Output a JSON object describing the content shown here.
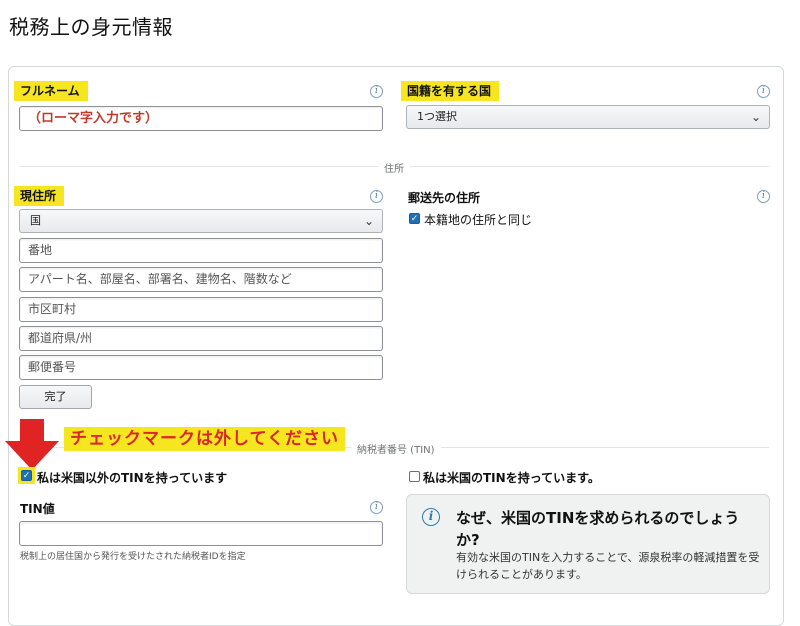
{
  "page": {
    "title": "税務上の身元情報"
  },
  "fullname": {
    "label": "フルネーム",
    "value": "（ローマ字入力です）"
  },
  "nationality": {
    "label": "国籍を有する国",
    "selected": "1つ選択"
  },
  "address_section": {
    "divider_label": "住所"
  },
  "current_address": {
    "label": "現住所",
    "country_selected": "国",
    "fields": [
      "番地",
      "アパート名、部屋名、部署名、建物名、階数など",
      "市区町村",
      "都道府県/州",
      "郵便番号"
    ],
    "done_button": "完了"
  },
  "mailing_address": {
    "label": "郵送先の住所",
    "same_as_label": "本籍地の住所と同じ",
    "same_as_checked": true
  },
  "tin_section": {
    "divider_label": "納税者番号 (TIN)"
  },
  "annotation": {
    "text": "チェックマークは外してください",
    "arrow_color": "#e02424"
  },
  "tin": {
    "non_us_option": "私は米国以外のTINを持っています",
    "non_us_checked": true,
    "us_option": "私は米国のTINを持っています。",
    "us_checked": false,
    "value_label": "TIN値",
    "value": "",
    "helper": "税制上の居住国から発行を受けたされた納税者IDを指定"
  },
  "why_box": {
    "title": "なぜ、米国のTINを求められるのでしょうか?",
    "body": "有効な米国のTINを入力することで、源泉税率の軽減措置を受けられることがあります。"
  },
  "colors": {
    "highlight": "#f5e61f",
    "annotation_text": "#d8272d",
    "checkbox": "#1f6fb5",
    "info_accent": "#2d7bb3"
  },
  "icons": {
    "info": "info-icon",
    "chevron": "chevron-down-icon",
    "arrow": "arrow-down-icon"
  }
}
